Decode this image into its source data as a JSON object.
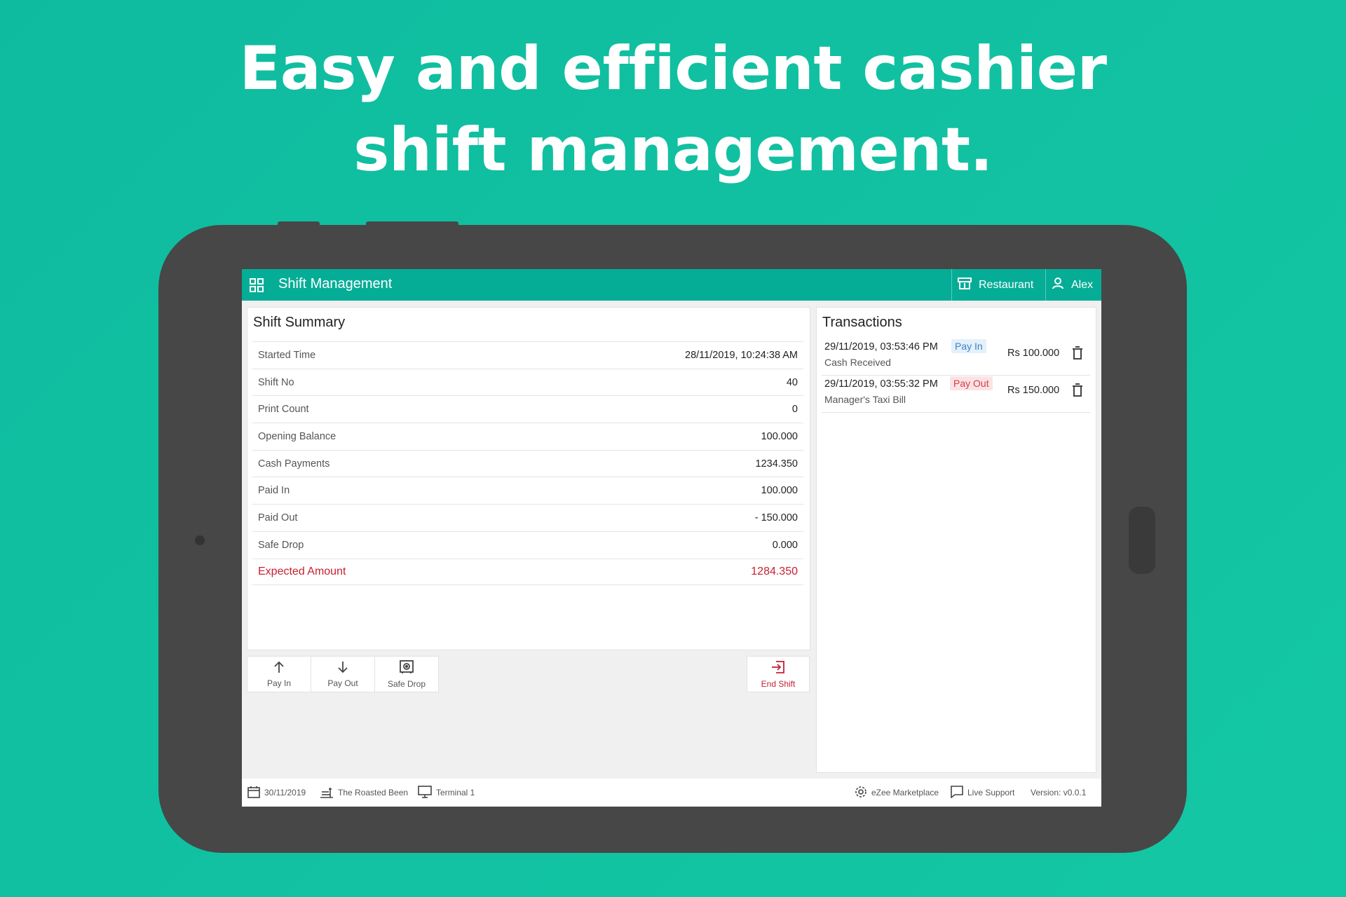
{
  "headline": {
    "line1": "Easy and efficient cashier",
    "line2": "shift management."
  },
  "app": {
    "title": "Shift Management",
    "outlet": "Restaurant",
    "user": "Alex",
    "accent_color": "#05ad97",
    "alert_color": "#c62033"
  },
  "summary": {
    "title": "Shift Summary",
    "rows": [
      {
        "label": "Started Time",
        "value": "28/11/2019, 10:24:38 AM"
      },
      {
        "label": "Shift No",
        "value": "40"
      },
      {
        "label": "Print Count",
        "value": "0"
      },
      {
        "label": "Opening Balance",
        "value": "100.000"
      },
      {
        "label": "Cash Payments",
        "value": "1234.350"
      },
      {
        "label": "Paid In",
        "value": "100.000"
      },
      {
        "label": "Paid Out",
        "value": "- 150.000"
      },
      {
        "label": "Safe Drop",
        "value": "0.000"
      },
      {
        "label": "Expected Amount",
        "value": "1284.350"
      }
    ]
  },
  "transactions": {
    "title": "Transactions",
    "items": [
      {
        "datetime": "29/11/2019, 03:53:46 PM",
        "type": "Pay In",
        "note": "Cash Received",
        "amount": "Rs 100.000",
        "icon": "trash-icon"
      },
      {
        "datetime": "29/11/2019, 03:55:32 PM",
        "type": "Pay Out",
        "note": "Manager's Taxi Bill",
        "amount": "Rs 150.000",
        "icon": "trash-icon"
      }
    ]
  },
  "actions": {
    "pay_in": "Pay In",
    "pay_out": "Pay Out",
    "safe_drop": "Safe Drop",
    "end_shift": "End Shift"
  },
  "status": {
    "date": "30/11/2019",
    "store": "The Roasted Been",
    "terminal": "Terminal 1",
    "marketplace": "eZee Marketplace",
    "support": "Live Support",
    "version": "Version: v0.0.1"
  }
}
